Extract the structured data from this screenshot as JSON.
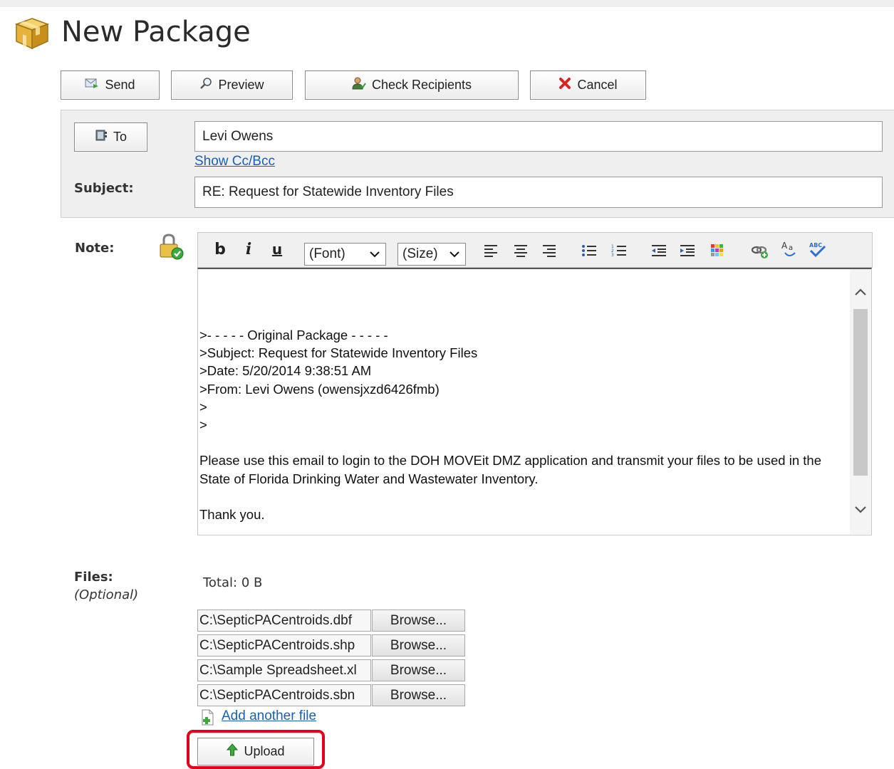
{
  "page": {
    "title": "New Package"
  },
  "toolbar": {
    "send": "Send",
    "preview": "Preview",
    "check_recipients": "Check Recipients",
    "cancel": "Cancel"
  },
  "header": {
    "to_button": "To",
    "to_value": "Levi Owens",
    "show_cc_bcc": "Show Cc/Bcc",
    "subject_label": "Subject:",
    "subject_value": "RE: Request for Statewide Inventory Files"
  },
  "note": {
    "label": "Note:",
    "format": {
      "bold": "b",
      "italic": "i",
      "underline": "u",
      "font_select": "(Font)",
      "size_select": "(Size)"
    },
    "body": ">- - - - - Original Package - - - - -\n>Subject: Request for Statewide Inventory Files\n>Date: 5/20/2014 9:38:51 AM\n>From: Levi Owens (owensjxzd6426fmb)\n>\n>\n\nPlease use this email to login to the DOH MOVEit DMZ application and transmit your files to be used in the State of Florida Drinking Water and Wastewater Inventory.\n\nThank you."
  },
  "files": {
    "label": "Files:",
    "optional": "(Optional)",
    "total": "Total: 0 B",
    "browse_label": "Browse...",
    "items": [
      {
        "path": "C:\\SepticPACentroids.dbf"
      },
      {
        "path": "C:\\SepticPACentroids.shp"
      },
      {
        "path": "C:\\Sample Spreadsheet.xl"
      },
      {
        "path": "C:\\SepticPACentroids.sbn"
      }
    ],
    "add_another": "Add another file",
    "upload": "Upload"
  },
  "colors": {
    "highlight": "#e3001b",
    "link": "#1a5fb4",
    "panel": "#efefef"
  }
}
